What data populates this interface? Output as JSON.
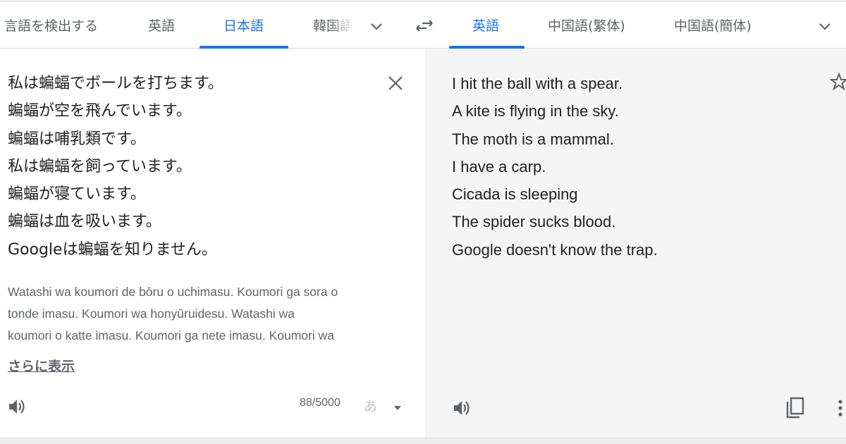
{
  "source_languages": [
    {
      "label": "言語を検出する",
      "active": false
    },
    {
      "label": "英語",
      "active": false
    },
    {
      "label": "日本語",
      "active": true
    },
    {
      "label": "韓国語",
      "active": false
    }
  ],
  "target_languages": [
    {
      "label": "英語",
      "active": true
    },
    {
      "label": "中国語(繁体)",
      "active": false
    },
    {
      "label": "中国語(簡体)",
      "active": false
    }
  ],
  "icons": {
    "more_source": "chevron-down-icon",
    "swap": "swap-icon",
    "more_target": "chevron-down-icon",
    "clear": "close-icon",
    "listen_source": "speaker-icon",
    "ime": "keyboard-icon",
    "star": "star-icon",
    "listen_target": "speaker-icon",
    "copy": "copy-icon",
    "more_options": "more-vert-icon"
  },
  "source_text": {
    "lines": [
      "私は蝙蝠でボールを打ちます。",
      "蝙蝠が空を飛んでいます。",
      "蝙蝠は哺乳類です。",
      "私は蝙蝠を飼っています。",
      "蝙蝠が寝ています。",
      "蝙蝠は血を吸います。",
      "Googleは蝙蝠を知りません。"
    ],
    "romanization": [
      "Watashi wa koumori de bōru o uchimasu. Koumori ga sora o",
      "tonde imasu. Koumori wa honyūruidesu. Watashi wa",
      "koumori o katte imasu. Koumori ga nete imasu. Koumori wa"
    ],
    "show_more": "さらに表示",
    "char_count": "88/5000",
    "ime_label": "あ"
  },
  "translation": {
    "lines": [
      "I hit the ball with a spear.",
      "A kite is flying in the sky.",
      "The moth is a mammal.",
      "I have a carp.",
      "Cicada is sleeping",
      "The spider sucks blood.",
      "Google doesn't know the trap."
    ]
  },
  "colors": {
    "accent": "#1a73e8",
    "text": "#202124",
    "muted": "#5f6368",
    "target_panel_bg": "#f5f5f5"
  }
}
